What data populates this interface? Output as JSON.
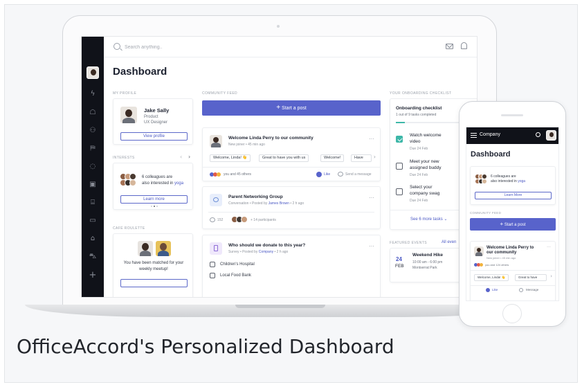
{
  "caption": "OfficeAccord's Personalized Dashboard",
  "desktop": {
    "search_placeholder": "Search anything..",
    "page_title": "Dashboard",
    "profile": {
      "section_label": "MY PROFILE",
      "name": "Jake Sally",
      "role_line1": "Product",
      "role_line2": "UX Designer",
      "view_profile": "View profile"
    },
    "interests": {
      "section_label": "INTERESTS",
      "text_part1": "6 colleagues are",
      "text_part2": "also interested in",
      "topic": "yoga",
      "learn_more": "Learn more"
    },
    "cafe": {
      "section_label": "CAFÉ ROULETTE",
      "line1": "You have been matched for your",
      "line2": "weekly meetup!"
    },
    "feed": {
      "section_label": "COMMUNITY FEED",
      "start_post": "Start a post",
      "post1": {
        "title": "Welcome Linda Perry to our community",
        "meta": "New joiner • 45 min ago",
        "chips": [
          "Welcome, Linda! 👋",
          "Great to have you with us",
          "Welcome!",
          "Have"
        ],
        "reactions_text": "you and 45 others",
        "like": "Like",
        "message": "Send a message"
      },
      "post2": {
        "title": "Parent Networking Group",
        "meta_prefix": "Conversation • Posted by",
        "meta_author": "James Brown",
        "meta_suffix": "• 2 h ago",
        "comments": "152",
        "participants": "+ 14 participants"
      },
      "post3": {
        "title": "Who should we donate to this year?",
        "meta_prefix": "Survey • Posted by",
        "meta_author": "Company",
        "meta_suffix": "• 2 h ago",
        "options": [
          "Children's Hospital",
          "Local Food Bank"
        ]
      }
    },
    "onboarding": {
      "section_label": "YOUR ONBOARDING CHECKLIST",
      "title": "Onboarding checklist",
      "progress_text": "1 out of 9 tasks completed",
      "progress": 0.11,
      "tasks": [
        {
          "line1": "Watch welcome",
          "line2": "video",
          "due": "Due 24 Feb",
          "done": true
        },
        {
          "line1": "Meet your new",
          "line2": "assigned buddy",
          "due": "Due 24 Feb",
          "done": false
        },
        {
          "line1": "Select your",
          "line2": "company swag",
          "due": "Due 24 Feb",
          "done": false
        }
      ],
      "see_more": "See 6 more tasks"
    },
    "events": {
      "section_label": "FEATURED EVENTS",
      "all_events": "All even",
      "day": "24",
      "month": "FEB",
      "title": "Weekend Hike",
      "time": "10:00 am - 6:00 pm",
      "place": "Montserrat Park"
    }
  },
  "mobile": {
    "company": "Company",
    "page_title": "Dashboard",
    "interests_line1": "6 colleagues are",
    "interests_line2": "also interested in",
    "interests_topic": "yoga",
    "learn_more": "Learn More",
    "feed_label": "COMMUNITY FEED",
    "start_post": "Start a post",
    "post_title_line1": "Welcome Linda Perry to",
    "post_title_line2": "our community",
    "post_meta": "New joiner • 45 min ago",
    "reactions_text": "you and 124 others",
    "chips": [
      "Welcome, Linda! 👋",
      "Great to have"
    ],
    "like": "Like",
    "message": "Message"
  },
  "colors": {
    "accent": "#5863cb",
    "sidebar": "#101219",
    "success": "#3db7a8",
    "text": "#1d2230"
  }
}
